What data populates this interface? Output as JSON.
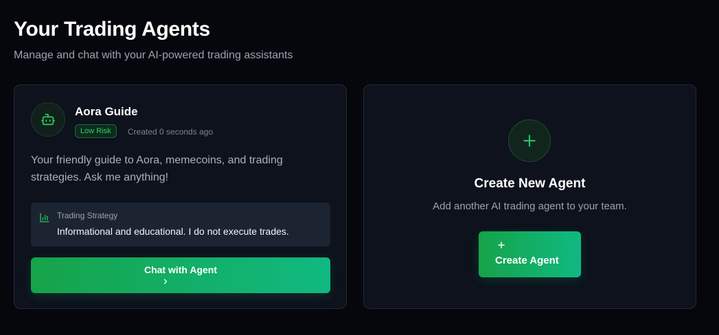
{
  "header": {
    "title": "Your Trading Agents",
    "subtitle": "Manage and chat with your AI-powered trading assistants"
  },
  "agents": [
    {
      "avatar_icon": "robot-icon",
      "name": "Aora Guide",
      "risk_badge": "Low Risk",
      "created": "Created 0 seconds ago",
      "description": "Your friendly guide to Aora, memecoins, and trading strategies. Ask me anything!",
      "strategy": {
        "icon": "bar-chart-icon",
        "label": "Trading Strategy",
        "text": "Informational and educational. I do not execute trades."
      },
      "chat_button": {
        "label": "Chat with Agent",
        "icon": "chevron-right-icon"
      }
    }
  ],
  "create_card": {
    "icon": "plus-icon",
    "title": "Create New Agent",
    "subtitle": "Add another AI trading agent to your team.",
    "button": {
      "icon": "plus-icon",
      "label": "Create Agent"
    }
  },
  "colors": {
    "background": "#05070d",
    "card": "#0d121c",
    "accent_green": "#22c55e",
    "gradient_start": "#16a34a",
    "gradient_end": "#10b981",
    "muted_text": "#9aa3b2"
  }
}
